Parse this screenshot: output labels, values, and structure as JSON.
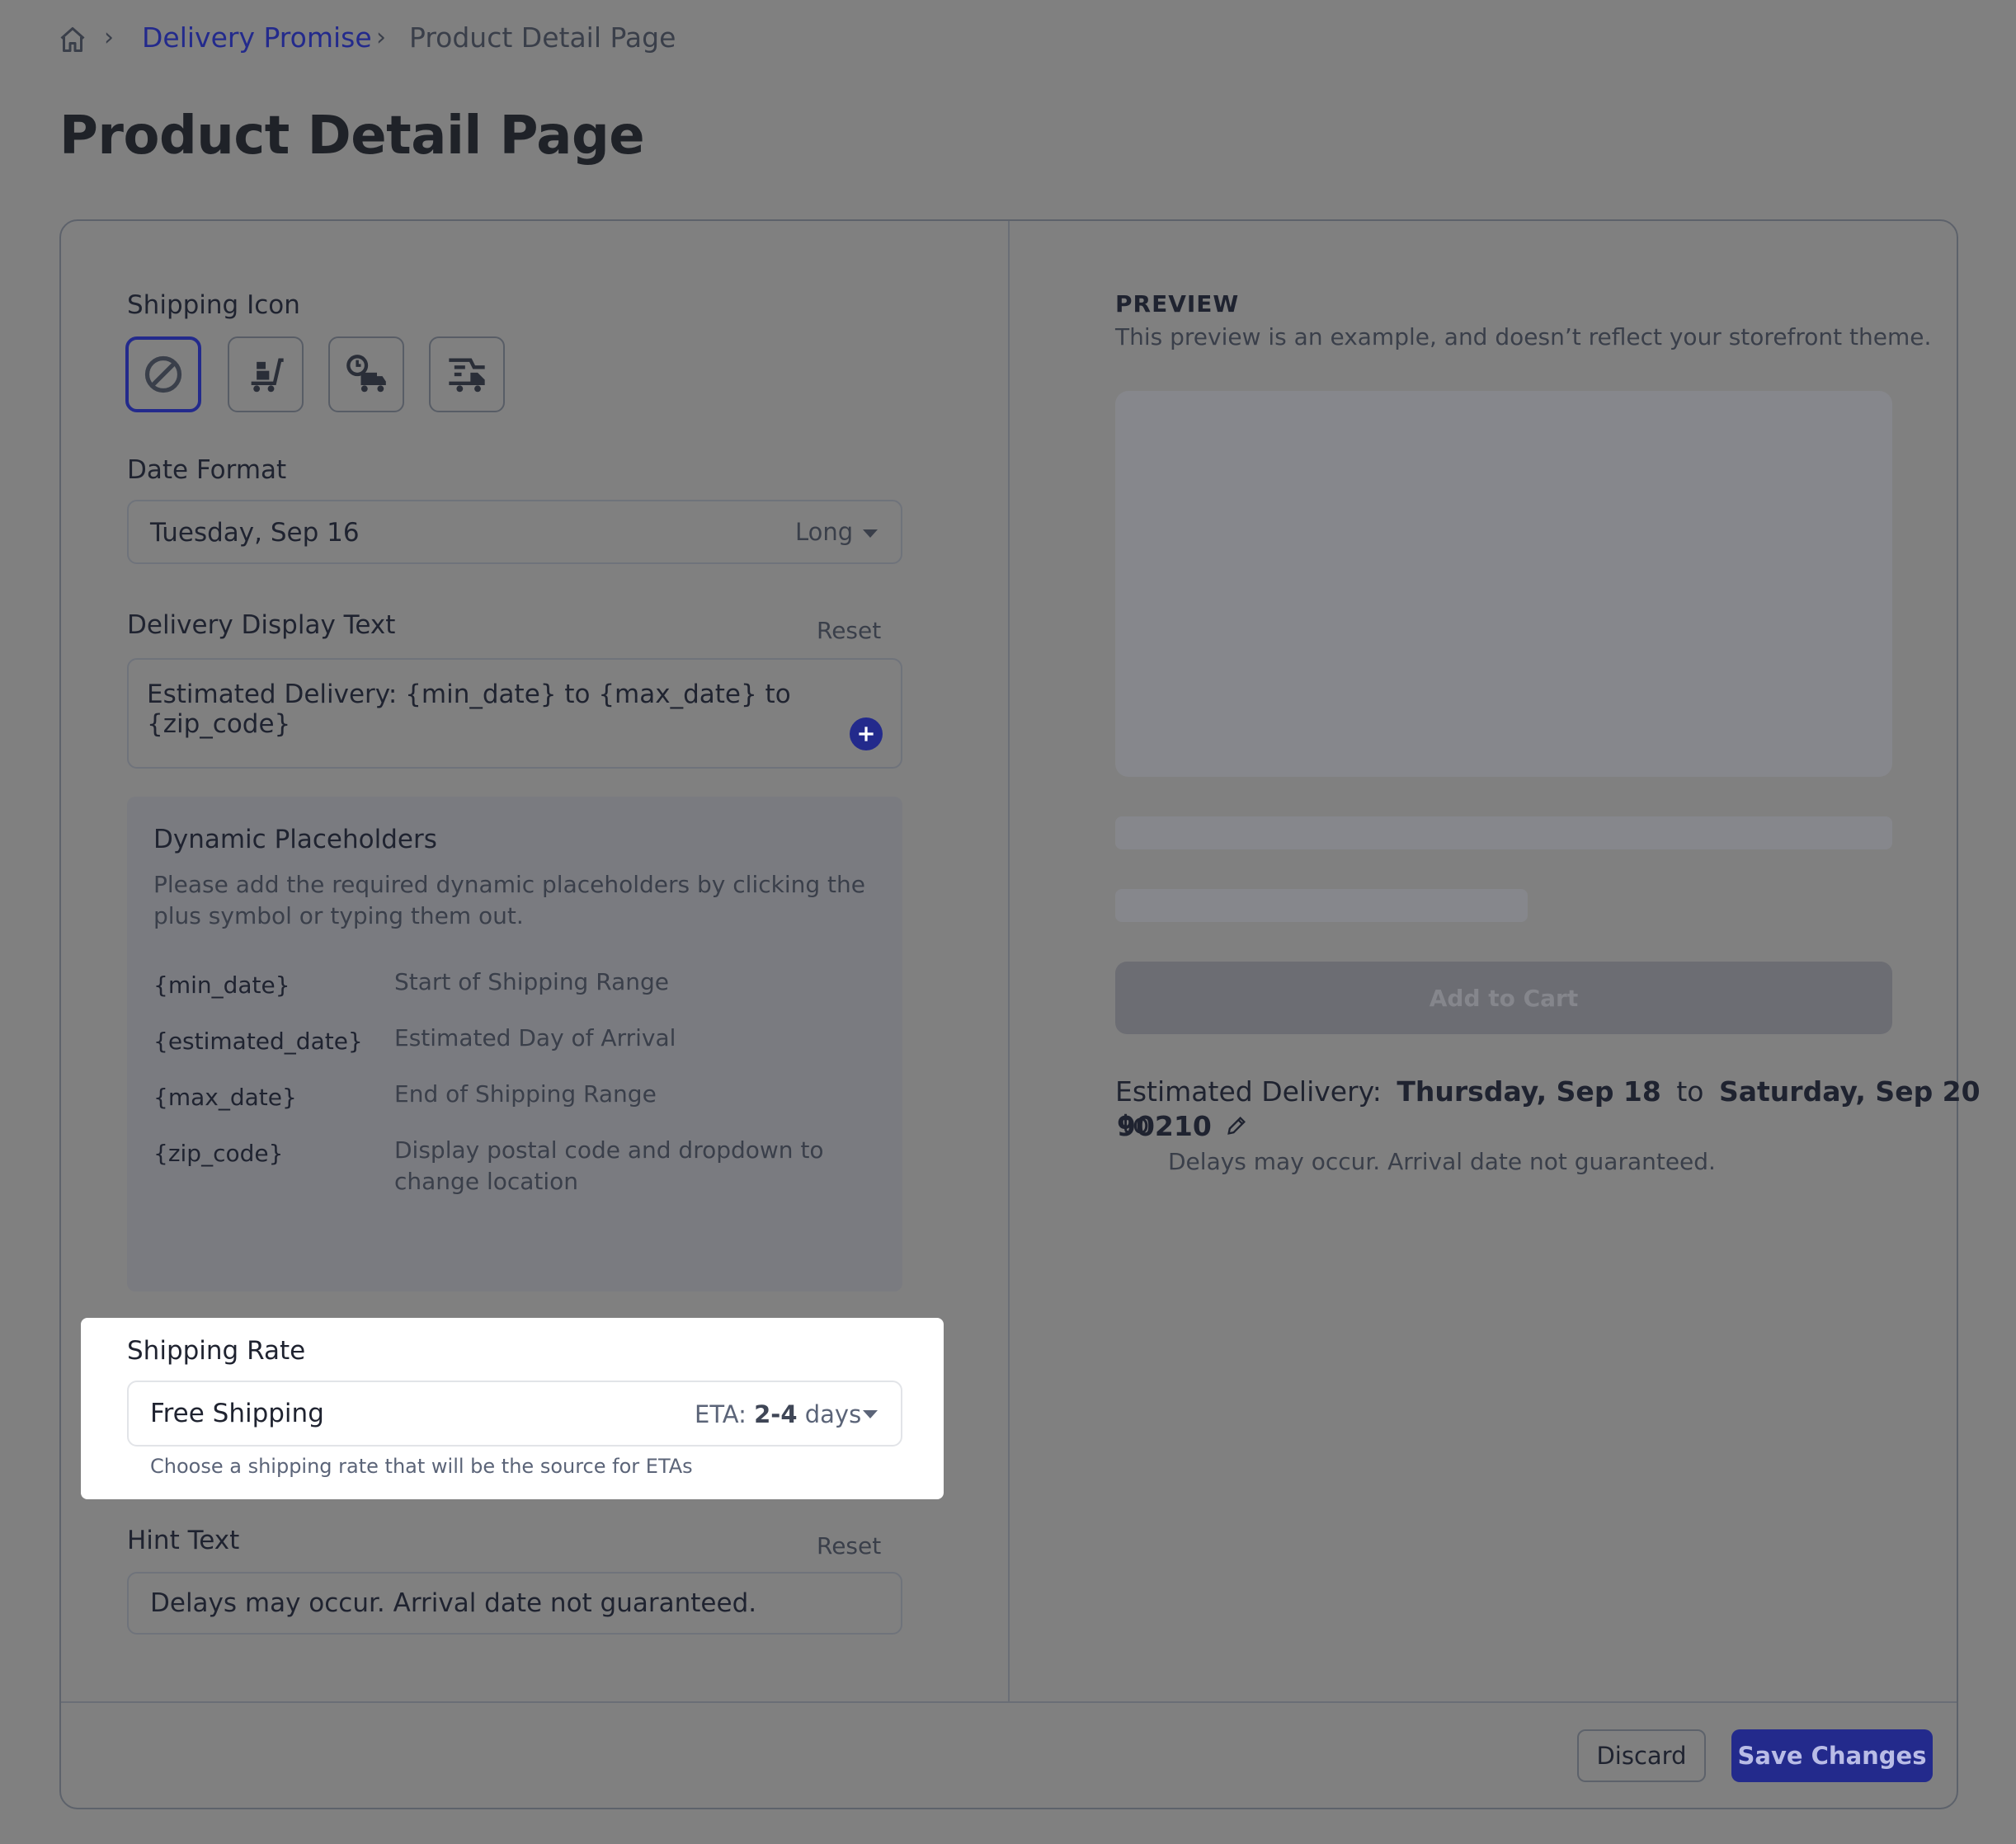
{
  "breadcrumb": {
    "home_icon": "home-icon",
    "link": "Delivery Promise",
    "current": "Product Detail Page",
    "separator": "›"
  },
  "page_title": "Product Detail Page",
  "shipping_icon": {
    "label": "Shipping Icon",
    "options": [
      "no-icon",
      "hand-truck-icon",
      "clock-truck-icon",
      "delivery-truck-icon"
    ],
    "selected": "no-icon"
  },
  "date_format": {
    "label": "Date Format",
    "value": "Tuesday, Sep 16",
    "format": "Long"
  },
  "delivery_text": {
    "label": "Delivery Display Text",
    "reset": "Reset",
    "value": "Estimated Delivery: {min_date} to {max_date} to {zip_code}"
  },
  "placeholders": {
    "title": "Dynamic Placeholders",
    "description": "Please add the required dynamic placeholders by clicking the plus symbol or typing them out.",
    "items": [
      {
        "key": "{min_date}",
        "desc": "Start of Shipping Range"
      },
      {
        "key": "{estimated_date}",
        "desc": "Estimated Day of Arrival"
      },
      {
        "key": "{max_date}",
        "desc": "End of Shipping Range"
      },
      {
        "key": "{zip_code}",
        "desc": "Display postal code and dropdown to change location"
      }
    ]
  },
  "shipping_rate": {
    "label": "Shipping Rate",
    "value": "Free Shipping",
    "eta_prefix": "ETA:",
    "eta_range": "2-4",
    "eta_suffix": "days",
    "help": "Choose a shipping rate that will be the source for ETAs"
  },
  "hint_text": {
    "label": "Hint Text",
    "reset": "Reset",
    "value": "Delays may occur. Arrival date not guaranteed."
  },
  "preview": {
    "title": "PREVIEW",
    "subtitle": "This preview is an example, and doesn’t reflect your storefront theme.",
    "cart_button": "Add to Cart",
    "est_prefix": "Estimated Delivery:",
    "min_date": "Thursday, Sep 18",
    "to1": "to",
    "max_date": "Saturday, Sep 20",
    "to2": "to",
    "zip": "90210",
    "hint": "Delays may occur. Arrival date not guaranteed."
  },
  "footer": {
    "discard": "Discard",
    "save": "Save Changes"
  },
  "colors": {
    "accent": "#232a8c",
    "overlay": "#808080",
    "highlight": "#ffffff"
  }
}
